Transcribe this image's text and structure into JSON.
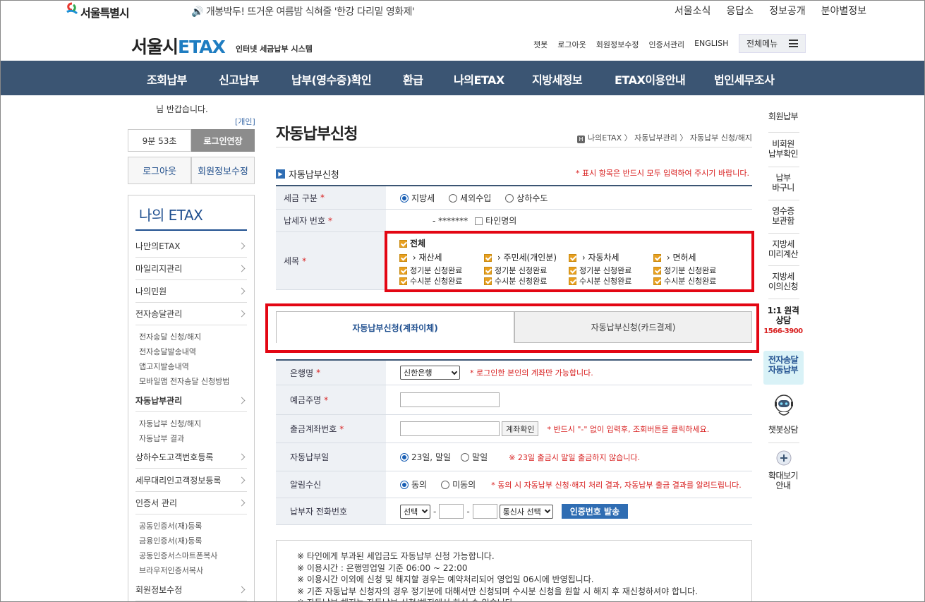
{
  "header": {
    "logo_text": "서울특별시",
    "notice": "🔊 개봉박두! 뜨거운 여름밤 식혀줄 '한강 다리밑 영화제'",
    "top_links": [
      "서울소식",
      "응답소",
      "정보공개",
      "분야별정보"
    ],
    "brand_main": "서울시",
    "brand_etax": "ETAX",
    "brand_sub": "인터넷 세금납부 시스템",
    "util_links": [
      "챗봇",
      "로그아웃",
      "회원정보수정",
      "인증서관리",
      "ENGLISH"
    ],
    "all_menu": "전체메뉴"
  },
  "gnb": [
    "조회납부",
    "신고납부",
    "납부(영수증)확인",
    "환급",
    "나의ETAX",
    "지방세정보",
    "ETAX이용안내",
    "법인세무조사"
  ],
  "sidebar": {
    "greeting": "님 반갑습니다.",
    "member_type": "[개인]",
    "timer": "9분 53초",
    "extend_label": "로그인연장",
    "logout_label": "로그아웃",
    "edit_label": "회원정보수정",
    "title": "나의 ETAX",
    "menu": [
      {
        "label": "나만의ETAX"
      },
      {
        "label": "마일리지관리"
      },
      {
        "label": "나의민원"
      },
      {
        "label": "전자송달관리"
      },
      {
        "label": "자동납부관리"
      },
      {
        "label": "상하수도고객번호등록"
      },
      {
        "label": "세무대리인고객정보등록"
      },
      {
        "label": "인증서 관리"
      },
      {
        "label": "회원정보수정"
      }
    ],
    "sub_esong": [
      "전자송달 신청/해지",
      "전자송달발송내역",
      "앱고지발송내역",
      "모바일앱 전자송달 신청방법"
    ],
    "sub_auto": [
      "자동납부 신청/해지",
      "자동납부 결과"
    ],
    "sub_cert": [
      "공동인증서(재)등록",
      "금융인증서(재)등록",
      "공동인증서스마트폰복사",
      "브라우저인증서복사"
    ]
  },
  "main": {
    "title": "자동납부신청",
    "breadcrumb": "나의ETAX 〉 자동납부관리 〉 자동납부 신청/해지",
    "breadcrumb_home": "H",
    "section_title": "자동납부신청",
    "required_note": "* 표시 항목은 반드시 모두 입력하여 주시기 바랍니다.",
    "tax_type_label": "세금 구분",
    "tax_types": [
      "지방세",
      "세외수입",
      "상하수도"
    ],
    "taxpayer_no_label": "납세자 번호",
    "taxpayer_no_value": "- *******",
    "other_name_label": "타인명의",
    "items_label": "세목",
    "all_label": "전체",
    "item_names": [
      "재산세",
      "주민세(개인분)",
      "자동차세",
      "면허세"
    ],
    "regular_done": "정기분 신청완료",
    "occasional_done": "수시분 신청완료",
    "tabs": [
      "자동납부신청(계좌이체)",
      "자동납부신청(카드결제)"
    ],
    "bank_label": "은행명",
    "bank_value": "신한은행",
    "bank_note": "* 로그인한 본인의 계좌만 가능합니다.",
    "holder_label": "예금주명",
    "account_label": "출금계좌번호",
    "account_btn": "계좌확인",
    "account_note": "* 반드시 \"-\" 없이 입력후, 조회버튼을 클릭하세요.",
    "payday_label": "자동납부일",
    "payday_opts": [
      "23일, 말일",
      "말일"
    ],
    "payday_note": "※ 23일 출금시 말일 출금하지 않습니다.",
    "alarm_label": "알림수신",
    "alarm_opts": [
      "동의",
      "미동의"
    ],
    "alarm_note": "* 동의 시 자동납부 신청·해지 처리 결과, 자동납부 출금 결과를 알려드립니다.",
    "phone_label": "납부자 전화번호",
    "phone_select": "선택",
    "carrier_select": "통신사 선택",
    "auth_btn": "인증번호 발송",
    "notes": [
      "※ 타인에게 부과된 세입금도 자동납부 신청 가능합니다.",
      "※ 이용시간 : 은행영업일 기준 06:00 ~ 22:00",
      "※ 이용시간 이외에 신청 및 해지할 경우는 예약처리되어 영업일 06시에 반영됩니다.",
      "※ 기존 자동납부 신청자의 경우 정기분에 대해서만 신청되며 수시분 신청을 원할 시 해지 후 재신청하셔야 합니다.",
      "※ 자동납부 해지는 자동납부 신청/해지에서 하실 수 있습니다."
    ]
  },
  "quick": {
    "items": [
      "회원납부",
      "비회원\n납부확인",
      "납부\n바구니",
      "영수증\n보관함",
      "지방세\n미리계산",
      "지방세\n이의신청",
      "1:1 원격\n상담"
    ],
    "phone": "1566-3900",
    "esong": "전자송달\n자동납부",
    "chatbot": "챗봇상담",
    "zoom": "확대보기\n안내"
  },
  "colors": {
    "nav_bg": "#3b5573",
    "accent": "#1f7dc1",
    "highlight": "#e30613",
    "required": "#d81f1f"
  }
}
